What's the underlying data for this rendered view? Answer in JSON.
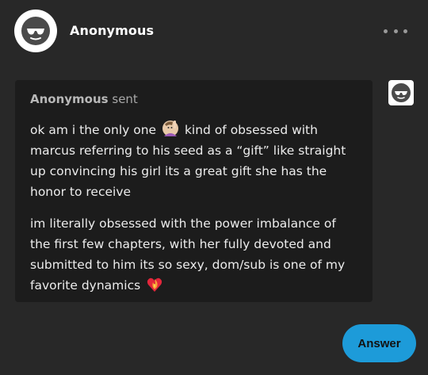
{
  "post": {
    "author": "Anonymous",
    "avatar_icon": "sunglasses-face-icon",
    "more_icon": "more-options-icon"
  },
  "ask": {
    "sender_name": "Anonymous",
    "sender_suffix": "sent",
    "paragraph1_before_emoji": "ok am i the only one",
    "paragraph1_emoji": "person-raising-hand-emoji",
    "paragraph1_after_emoji": "kind of obsessed with marcus referring to his seed as a “gift” like straight up convincing his girl its a great gift she has the honor to receive",
    "paragraph2": "im literally obsessed with the power imbalance of the first few chapters, with her fully devoted and submitted to him its so sexy, dom/sub is one of my favorite dynamics",
    "paragraph2_emoji": "heart-on-fire-emoji"
  },
  "actions": {
    "answer_label": "Answer"
  },
  "colors": {
    "background": "#282828",
    "bubble": "#1c1c1c",
    "accent": "#1d9bd9"
  }
}
